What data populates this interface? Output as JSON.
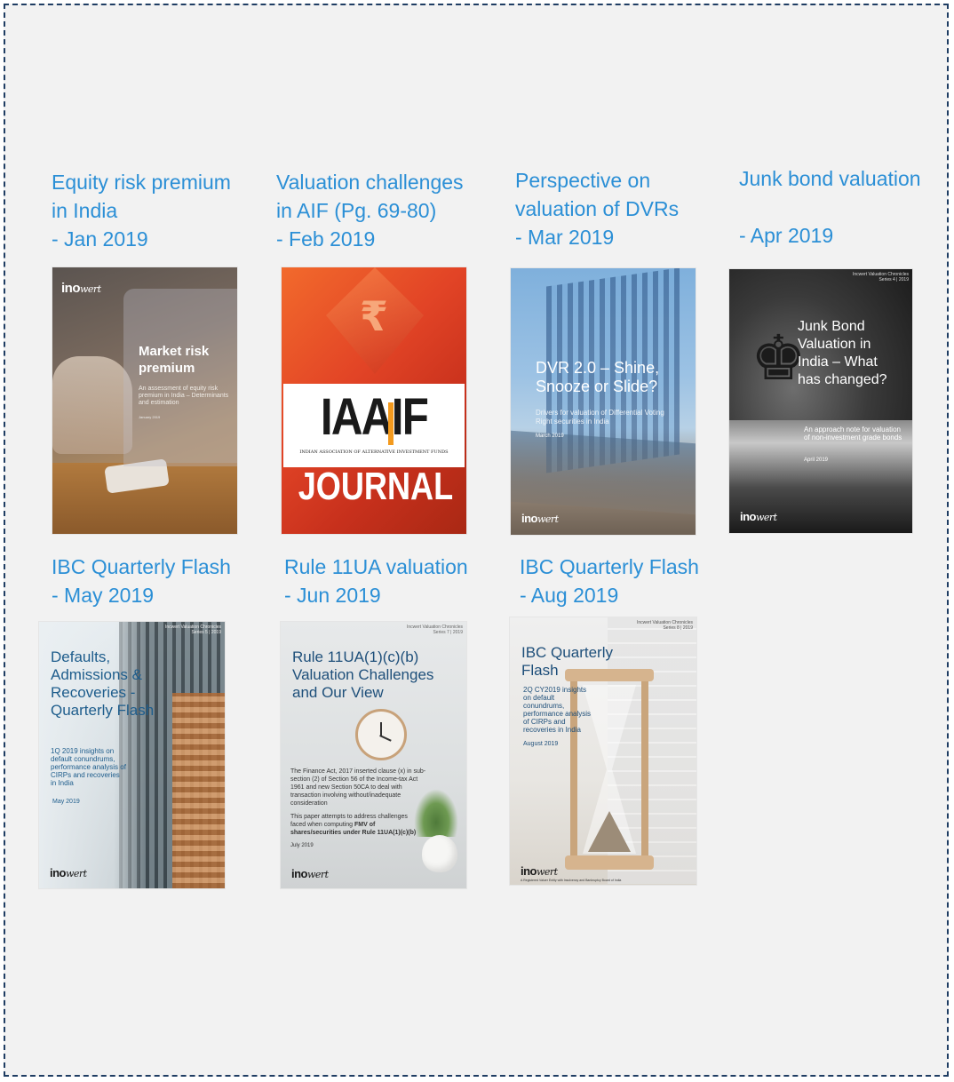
{
  "publications": [
    {
      "title": "Equity risk premium\nin India\n - Jan 2019",
      "cover": {
        "heading": "Market risk premium",
        "subtitle": "An assessment of equity risk premium in India – Determinants and estimation",
        "date": "January 2019",
        "logo": "inc"
      }
    },
    {
      "title": "Valuation challenges\nin AIF (Pg. 69-80)\n - Feb 2019",
      "cover": {
        "brand": "IAAIF",
        "brand_sub": "INDIAN ASSOCIATION OF ALTERNATIVE INVESTMENT FUNDS",
        "journal": "JOURNAL",
        "symbol": "₹"
      }
    },
    {
      "title": "Perspective on\nvaluation of DVRs\n - Mar 2019",
      "cover": {
        "heading": "DVR 2.0 – Shine, Snooze or Slide?",
        "subtitle": "Drivers for valuation of Differential Voting Right securities in India",
        "date": "March 2019",
        "logo": "inc"
      }
    },
    {
      "title": "Junk bond valuation\n\n- Apr 2019",
      "cover": {
        "series": "Incwert Valuation Chronicles\nSeries 4 | 2019",
        "heading": "Junk Bond Valuation in India – What has changed?",
        "subtitle": "An approach note for valuation of non-investment grade bonds",
        "date": "April 2019",
        "logo": "inc"
      }
    },
    {
      "title": "IBC Quarterly Flash\n - May 2019",
      "cover": {
        "series": "Incwert Valuation Chronicles\nSeries 5 | 2019",
        "heading": "Defaults, Admissions & Recoveries - Quarterly Flash",
        "subtitle": "1Q 2019 insights on default conundrums, performance analysis of CIRPs and recoveries in India",
        "date": "May 2019",
        "logo": "inc"
      }
    },
    {
      "title": "Rule 11UA valuation\n - Jun 2019",
      "cover": {
        "series": "Incwert Valuation Chronicles\nSeries 7 | 2019",
        "heading": "Rule 11UA(1)(c)(b) Valuation Challenges and Our View",
        "body1": "The Finance Act, 2017 inserted clause (x) in sub-section (2) of Section 56 of the Income-tax Act 1961 and new Section 50CA to deal with transaction involving without/inadequate consideration",
        "body2a": "This paper attempts to address challenges faced when computing ",
        "body2b": "FMV of shares/securities under Rule 11UA(1)(c)(b)",
        "date": "July 2019",
        "logo": "inc"
      }
    },
    {
      "title": "IBC Quarterly Flash\n - Aug 2019",
      "cover": {
        "series": "Incwert Valuation Chronicles\nSeries 8 | 2019",
        "heading": "IBC Quarterly Flash",
        "subtitle": "2Q CY2019 insights on default conundrums, performance analysis of CIRPs and recoveries in India",
        "date": "August 2019",
        "footer": "A Registered Valuer Entity with Insolvency and Bankruptcy Board of India",
        "logo": "inc"
      }
    }
  ],
  "colors": {
    "link": "#2b8fd6",
    "border": "#1f3d63",
    "panel": "#f2f2f2"
  }
}
